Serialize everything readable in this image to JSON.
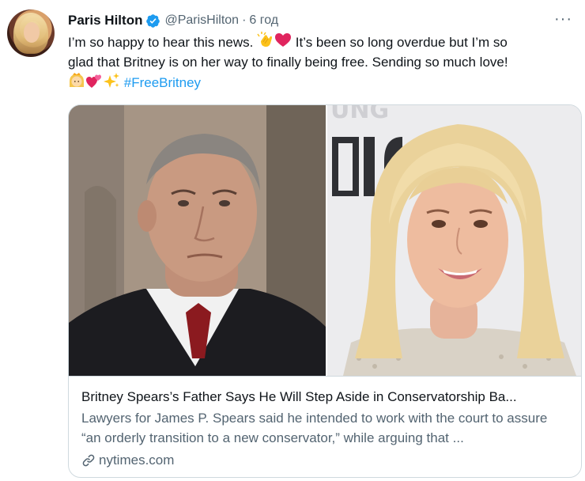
{
  "tweet": {
    "author": {
      "name": "Paris Hilton",
      "handle": "@ParisHilton",
      "separator": "·",
      "time": "6 год",
      "verified": true
    },
    "more_icon": "more-horizontal-icon",
    "text": {
      "line1_a": "I’m so happy to hear this news. ",
      "line1_b": " It’s been so long overdue but I’m so",
      "line2": "glad that Britney is on her way to finally being free. Sending so much love!",
      "hashtag": "#FreeBritney"
    },
    "emojis": [
      "clapping-hands",
      "red-heart",
      "princess",
      "two-hearts",
      "sparkles"
    ]
  },
  "card": {
    "title": "Britney Spears’s Father Says He Will Step Aside in Conservatorship Ba...",
    "description": "Lawyers for James P. Spears said he intended to work with the court to assure “an orderly transition to a new conservator,” while arguing that ...",
    "domain": "nytimes.com",
    "backdrop_text": "UNG"
  },
  "colors": {
    "link": "#1d9bf0",
    "text": "#0f1419",
    "secondary": "#536471",
    "border": "#cfd9de",
    "verified": "#1d9bf0"
  }
}
